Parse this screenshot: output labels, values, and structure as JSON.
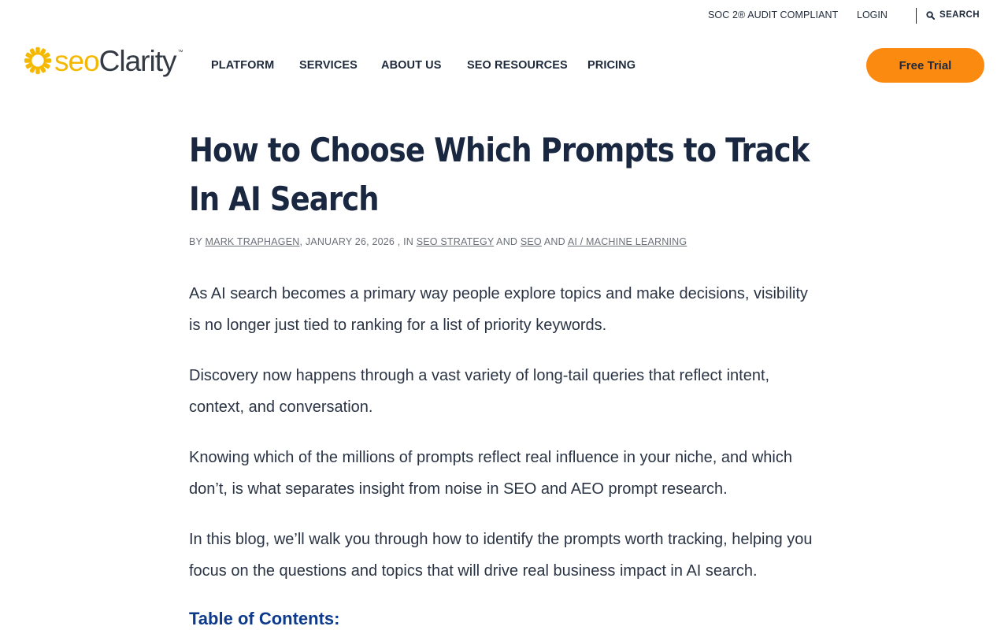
{
  "utility": {
    "soc": "SOC 2® AUDIT COMPLIANT",
    "login": "LOGIN",
    "search": "SEARCH"
  },
  "logo": {
    "seo": "seo",
    "clarity": "Clarity",
    "tm": "™"
  },
  "nav": [
    "PLATFORM",
    "SERVICES",
    "ABOUT US",
    "SEO RESOURCES",
    "PRICING"
  ],
  "cta": "Free Trial",
  "article": {
    "title": "How to Choose Which Prompts to Track In AI Search",
    "byline": {
      "by": "BY",
      "author": "MARK TRAPHAGEN",
      "date_in": ", JANUARY 26, 2026 , IN",
      "cat1": "SEO STRATEGY",
      "and1": "AND",
      "cat2": "SEO",
      "and2": "AND",
      "cat3": "AI / MACHINE LEARNING"
    },
    "paragraphs": [
      "As AI search becomes a primary way people explore topics and make decisions, visibility is no longer just tied to ranking for a list of priority keywords.",
      "Discovery now happens through a vast variety of long-tail queries that reflect intent, context, and conversation.",
      "Knowing which of the millions of prompts reflect real influence in your niche, and which don’t, is what separates insight from noise in SEO and AEO prompt research.",
      "In this blog, we’ll walk you through how to identify the prompts worth tracking, helping you focus on the questions and topics that will drive real business impact in AI search."
    ],
    "toc_heading": "Table of Contents:"
  },
  "colors": {
    "accent": "#fb8a11",
    "logo_yellow": "#f5b800",
    "heading": "#1a2740",
    "toc_blue": "#0d3a8a"
  },
  "icons": {
    "search": "search-icon",
    "logo": "sun-logo-icon"
  }
}
